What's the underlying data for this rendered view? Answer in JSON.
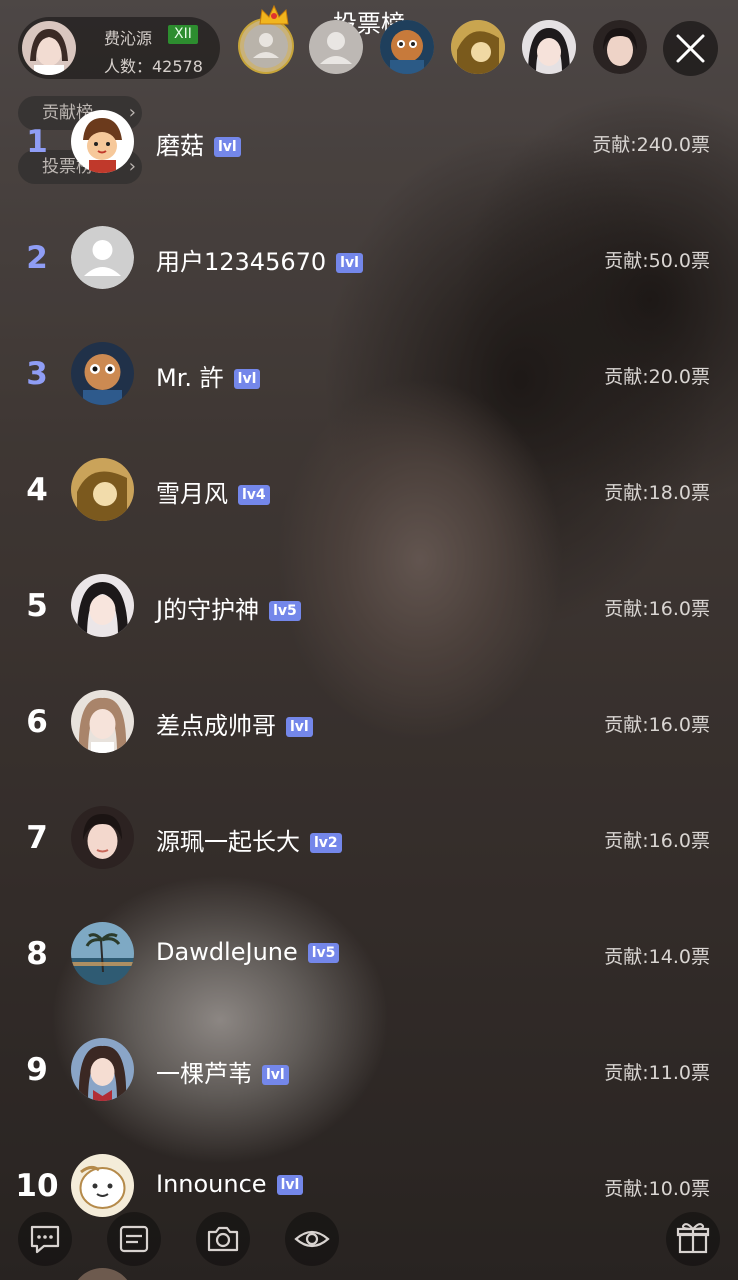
{
  "header": {
    "title": "投票榜",
    "host_name": "费沁源",
    "host_badge": "XII",
    "viewer_count": "人数：42578",
    "contribution_tab": "贡献榜",
    "vote_tab": "投票榜"
  },
  "ranking": [
    {
      "rank": "1",
      "name": "磨菇",
      "level": "lvl",
      "score": "贡献:240.0票"
    },
    {
      "rank": "2",
      "name": "用户12345670",
      "level": "lvl",
      "score": "贡献:50.0票"
    },
    {
      "rank": "3",
      "name": "Mr. 許",
      "level": "lvl",
      "score": "贡献:20.0票"
    },
    {
      "rank": "4",
      "name": "雪月风",
      "level": "lv4",
      "score": "贡献:18.0票"
    },
    {
      "rank": "5",
      "name": "J的守护神",
      "level": "lv5",
      "score": "贡献:16.0票"
    },
    {
      "rank": "6",
      "name": "差点成帅哥",
      "level": "lvl",
      "score": "贡献:16.0票"
    },
    {
      "rank": "7",
      "name": "源珮一起长大",
      "level": "lv2",
      "score": "贡献:16.0票"
    },
    {
      "rank": "8",
      "name": "DawdleJune",
      "level": "lv5",
      "score": "贡献:14.0票"
    },
    {
      "rank": "9",
      "name": "一棵芦苇",
      "level": "lvl",
      "score": "贡献:11.0票"
    },
    {
      "rank": "10",
      "name": "Innounce",
      "level": "lvl",
      "score": "贡献:10.0票"
    }
  ],
  "toolbar": {
    "icons": [
      "chat-icon",
      "message-icon",
      "camera-icon",
      "eye-icon",
      "gift-icon"
    ]
  },
  "colors": {
    "top_rank": "#8f9df5",
    "level_badge": "#7487ea",
    "host_badge": "#2d8d2f"
  }
}
